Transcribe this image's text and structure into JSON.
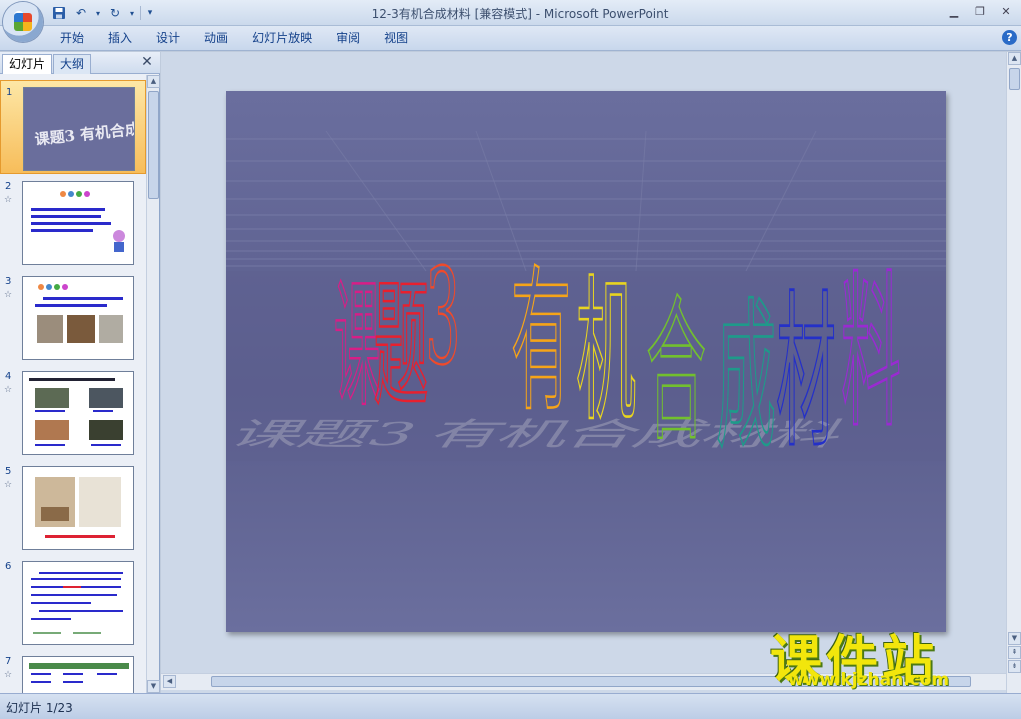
{
  "window": {
    "title": "12-3有机合成材料 [兼容模式] - Microsoft PowerPoint"
  },
  "ribbon": {
    "tabs": [
      "开始",
      "插入",
      "设计",
      "动画",
      "幻灯片放映",
      "审阅",
      "视图"
    ]
  },
  "panel": {
    "tabs": [
      "幻灯片",
      "大纲"
    ]
  },
  "thumbnails": [
    {
      "num": "1"
    },
    {
      "num": "2"
    },
    {
      "num": "3"
    },
    {
      "num": "4"
    },
    {
      "num": "5"
    },
    {
      "num": "6"
    },
    {
      "num": "7"
    }
  ],
  "slide": {
    "title_chars": [
      "课",
      "题",
      "3",
      "有",
      "机",
      "合",
      "成",
      "材",
      "料"
    ],
    "colors": [
      "#d81e86",
      "#e8202e",
      "#f04a2a",
      "#f6a418",
      "#e8d420",
      "#72c02e",
      "#1e9a8a",
      "#2430c8",
      "#9a2ad2"
    ],
    "background": "#666a98"
  },
  "status": {
    "text": "幻灯片 1/23"
  },
  "watermark": {
    "brand": "课件站",
    "url": "www.kjzhan.com"
  },
  "colors": {
    "selection": "#f7bd5a",
    "ribbon_text": "#15428b"
  }
}
